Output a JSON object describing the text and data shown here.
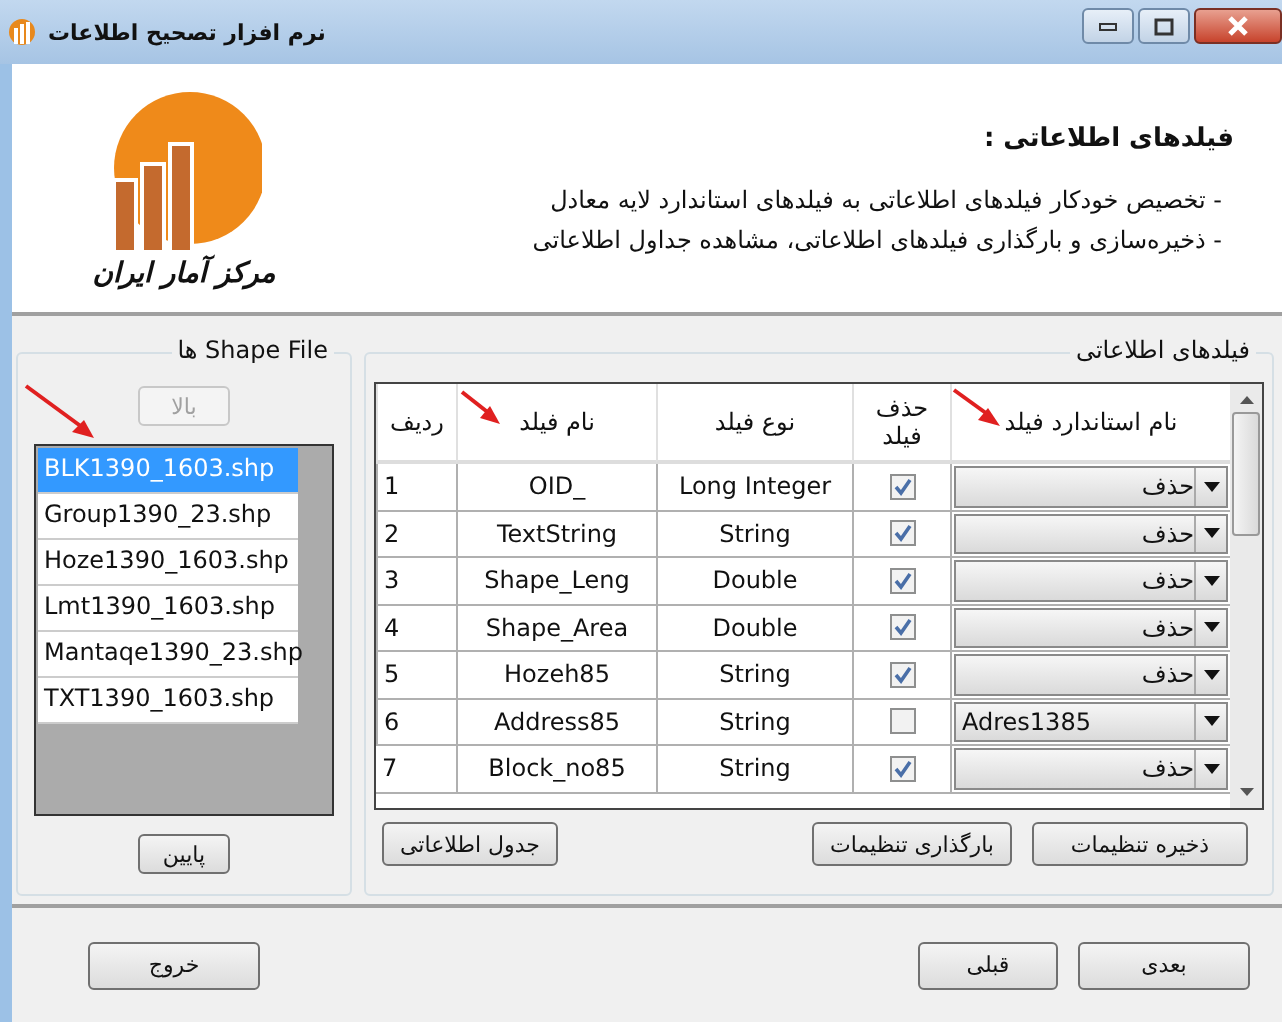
{
  "window": {
    "title": "نرم افزار تصحیح اطلاعات"
  },
  "header": {
    "logo_caption": "مرکز آمار ایران",
    "heading": "فیلدهای اطلاعاتی :",
    "bullets": [
      "- تخصیص خودکار فیلدهای اطلاعاتی به فیلدهای استاندارد لایه معادل",
      "- ذخیره‌سازی و بارگذاری فیلدهای اطلاعاتی، مشاهده جداول اطلاعاتی"
    ]
  },
  "shape_files": {
    "title": "Shape File ها",
    "up_button": {
      "label": "بالا",
      "disabled": true
    },
    "down_button": {
      "label": "پایین",
      "disabled": false
    },
    "files": [
      {
        "name": "BLK1390_1603.shp",
        "selected": true
      },
      {
        "name": "Group1390_23.shp",
        "selected": false
      },
      {
        "name": "Hoze1390_1603.shp",
        "selected": false
      },
      {
        "name": "Lmt1390_1603.shp",
        "selected": false
      },
      {
        "name": "Mantaqe1390_23.shp",
        "selected": false
      },
      {
        "name": "TXT1390_1603.shp",
        "selected": false
      }
    ]
  },
  "fields": {
    "title": "فیلدهای اطلاعاتی",
    "columns": [
      "نام استاندارد فیلد",
      "حذف فیلد",
      "نوع فیلد",
      "نام فیلد",
      "ردیف"
    ],
    "rows": [
      {
        "row": "1",
        "name": "OID_",
        "type": "Long Integer",
        "delete": true,
        "standard": "حذف"
      },
      {
        "row": "2",
        "name": "TextString",
        "type": "String",
        "delete": true,
        "standard": "حذف"
      },
      {
        "row": "3",
        "name": "Shape_Leng",
        "type": "Double",
        "delete": true,
        "standard": "حذف"
      },
      {
        "row": "4",
        "name": "Shape_Area",
        "type": "Double",
        "delete": true,
        "standard": "حذف"
      },
      {
        "row": "5",
        "name": "Hozeh85",
        "type": "String",
        "delete": true,
        "standard": "حذف"
      },
      {
        "row": "6",
        "name": "Address85",
        "type": "String",
        "delete": false,
        "standard": "Adres1385"
      },
      {
        "row": "7",
        "name": "Block_no85",
        "type": "String",
        "delete": true,
        "standard": "حذف"
      }
    ],
    "buttons": [
      "ذخیره تنظیمات",
      "بارگذاری تنظیمات",
      "جدول اطلاعاتی"
    ]
  },
  "footer": {
    "buttons": [
      "بعدی",
      "قبلی",
      "خروج"
    ]
  }
}
